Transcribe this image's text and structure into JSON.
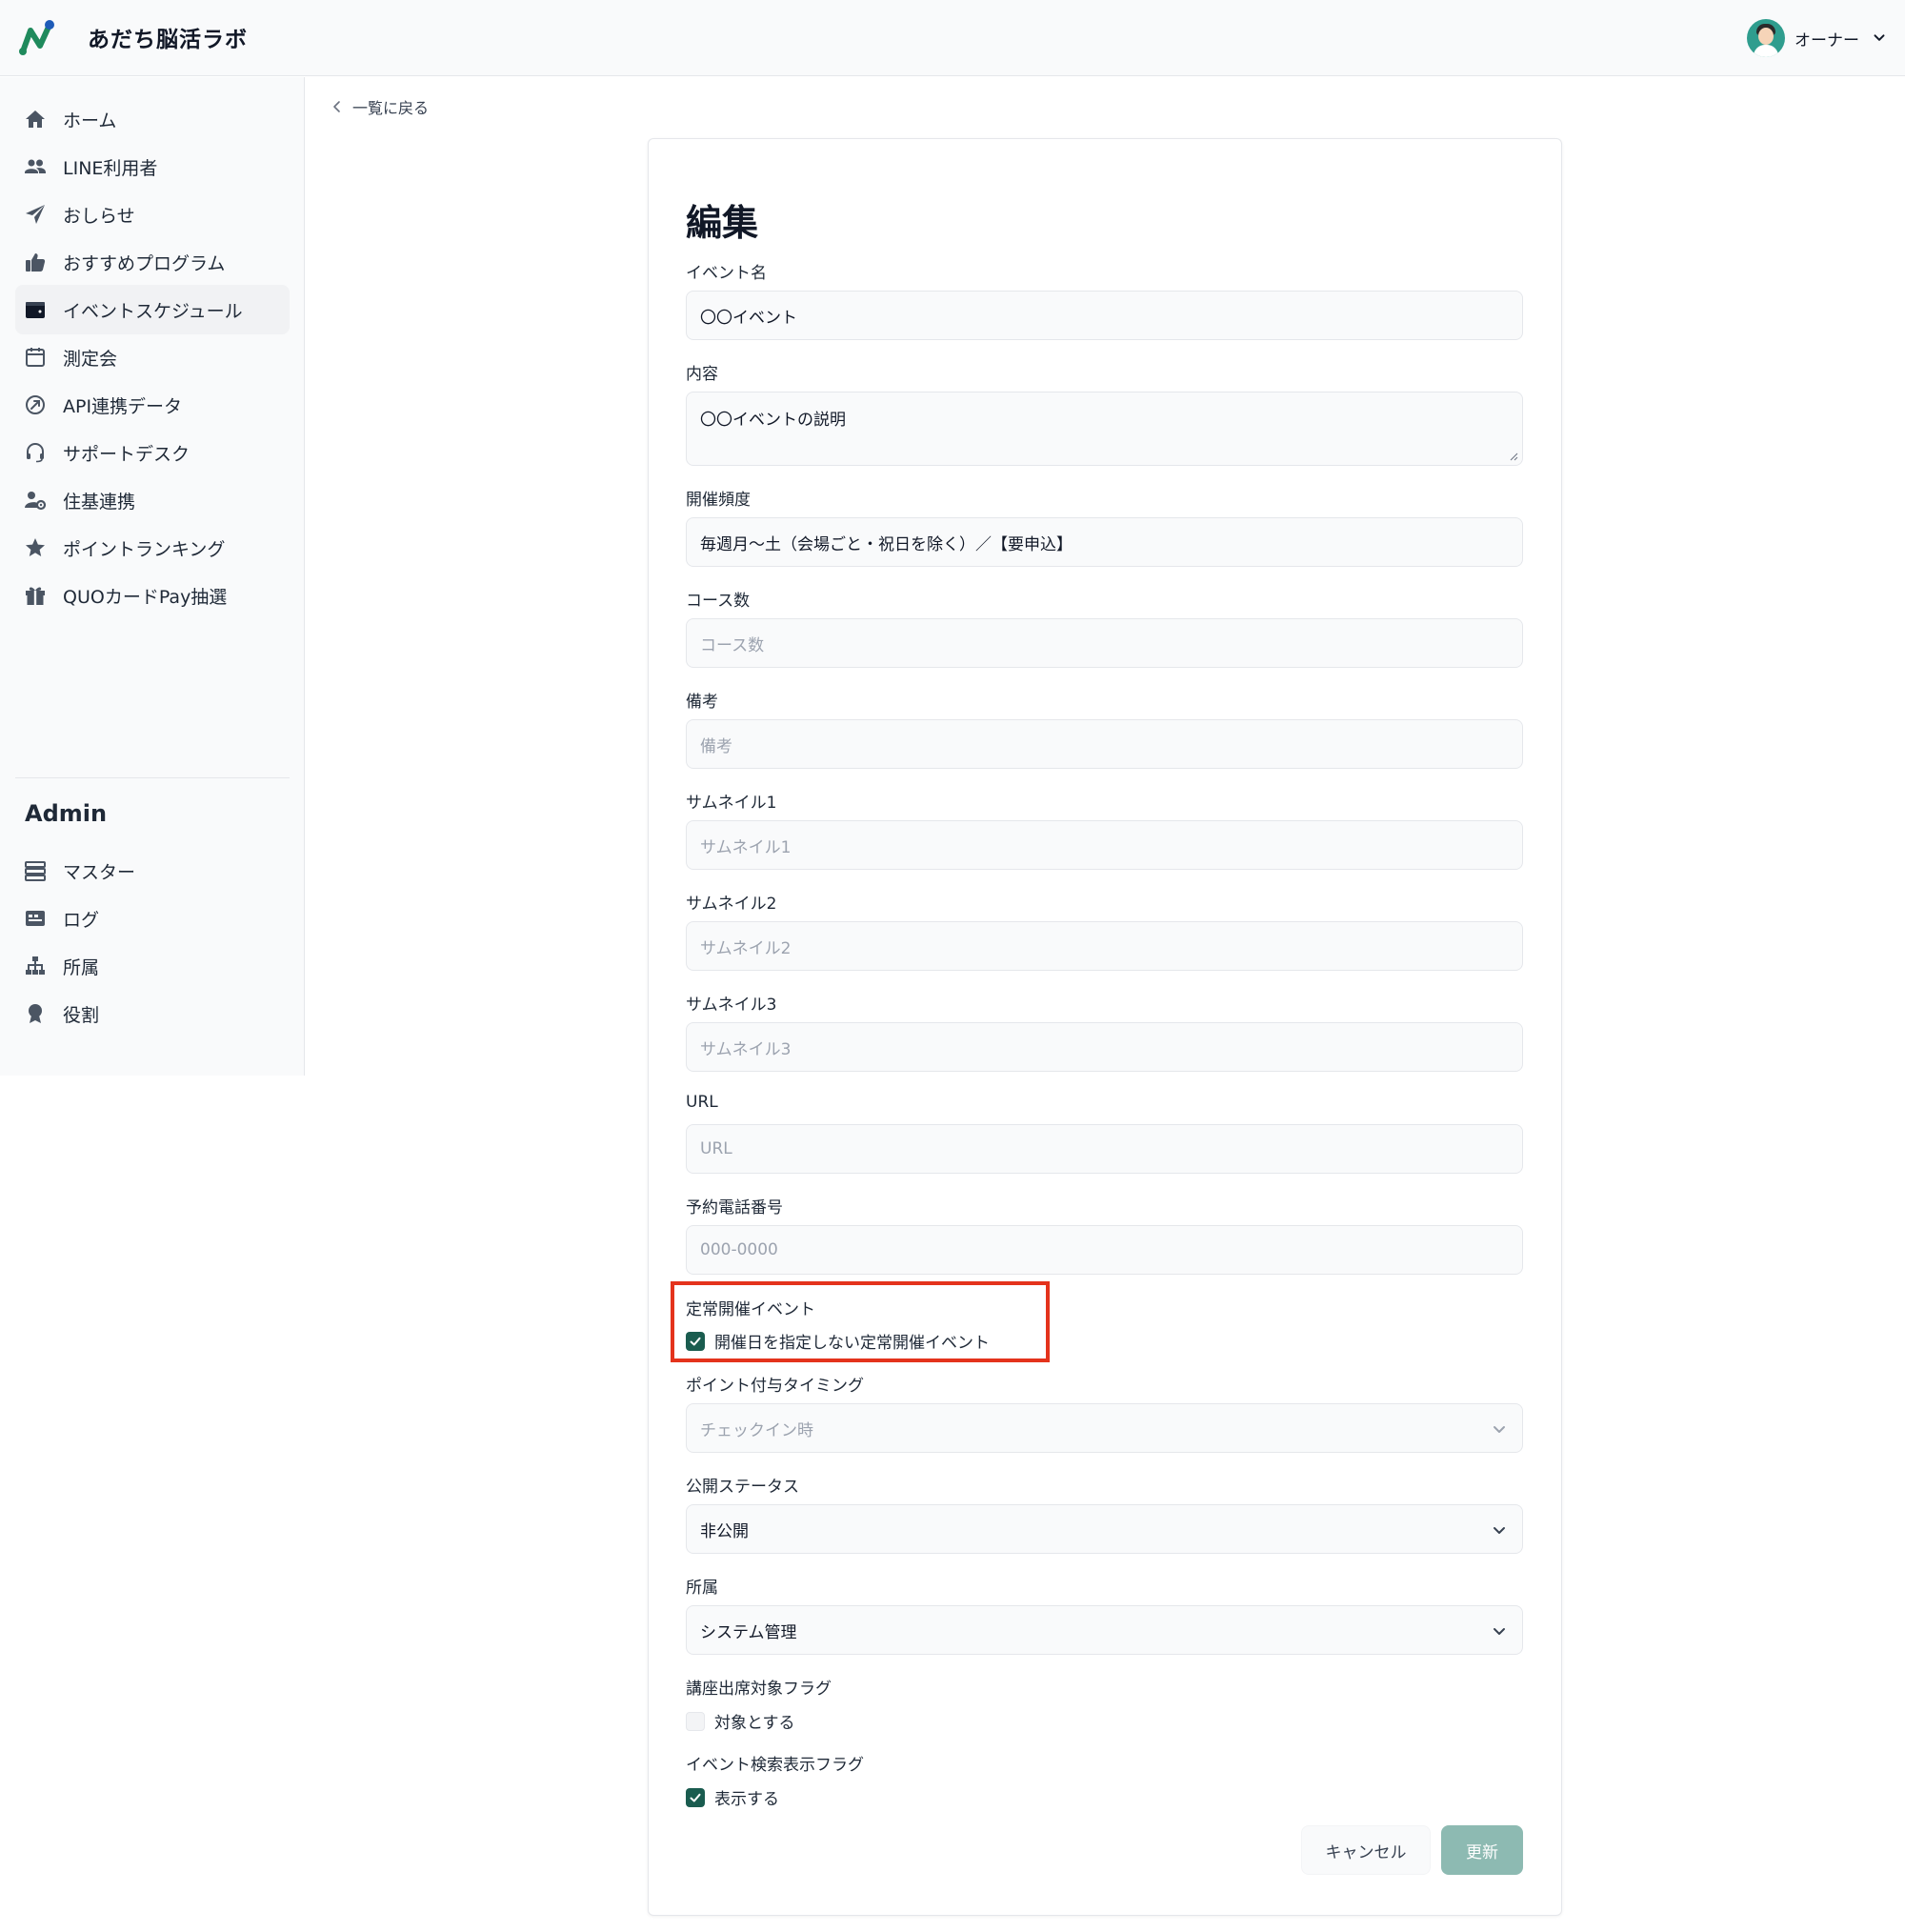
{
  "app": {
    "title": "あだち脳活ラボ"
  },
  "user": {
    "name": "オーナー"
  },
  "sidebar": {
    "items": [
      {
        "label": "ホーム",
        "icon": "home-icon"
      },
      {
        "label": "LINE利用者",
        "icon": "users-icon"
      },
      {
        "label": "おしらせ",
        "icon": "paper-plane-icon"
      },
      {
        "label": "おすすめプログラム",
        "icon": "thumbs-up-icon"
      },
      {
        "label": "イベントスケジュール",
        "icon": "wallet-icon",
        "active": true
      },
      {
        "label": "測定会",
        "icon": "calendar-icon"
      },
      {
        "label": "API連携データ",
        "icon": "api-link-icon"
      },
      {
        "label": "サポートデスク",
        "icon": "headset-icon"
      },
      {
        "label": "住基連携",
        "icon": "user-gear-icon"
      },
      {
        "label": "ポイントランキング",
        "icon": "star-icon"
      },
      {
        "label": "QUOカードPay抽選",
        "icon": "gift-icon"
      }
    ],
    "admin_heading": "Admin",
    "admin_items": [
      {
        "label": "マスター",
        "icon": "server-icon"
      },
      {
        "label": "ログ",
        "icon": "log-card-icon"
      },
      {
        "label": "所属",
        "icon": "sitemap-icon"
      },
      {
        "label": "役割",
        "icon": "award-icon"
      }
    ]
  },
  "main": {
    "back_label": "一覧に戻る",
    "title": "編集",
    "form": {
      "event_name": {
        "label": "イベント名",
        "value": "〇〇イベント"
      },
      "content": {
        "label": "内容",
        "value": "〇〇イベントの説明"
      },
      "frequency": {
        "label": "開催頻度",
        "value": "毎週月〜土（会場ごと・祝日を除く）／【要申込】"
      },
      "course_count": {
        "label": "コース数",
        "placeholder": "コース数"
      },
      "notes": {
        "label": "備考",
        "placeholder": "備考"
      },
      "thumbnail1": {
        "label": "サムネイル1",
        "placeholder": "サムネイル1"
      },
      "thumbnail2": {
        "label": "サムネイル2",
        "placeholder": "サムネイル2"
      },
      "thumbnail3": {
        "label": "サムネイル3",
        "placeholder": "サムネイル3"
      },
      "url": {
        "label": "URL",
        "placeholder": "URL"
      },
      "phone": {
        "label": "予約電話番号",
        "placeholder": "000-0000"
      },
      "recurring": {
        "label": "定常開催イベント",
        "checkbox_label": "開催日を指定しない定常開催イベント",
        "checked": true
      },
      "point_timing": {
        "label": "ポイント付与タイミング",
        "value": "チェックイン時",
        "disabled": true
      },
      "publish_status": {
        "label": "公開ステータス",
        "value": "非公開"
      },
      "affiliation": {
        "label": "所属",
        "value": "システム管理"
      },
      "attendance_flag": {
        "label": "講座出席対象フラグ",
        "checkbox_label": "対象とする",
        "checked": false
      },
      "search_flag": {
        "label": "イベント検索表示フラグ",
        "checkbox_label": "表示する",
        "checked": true
      }
    },
    "buttons": {
      "cancel": "キャンセル",
      "update": "更新"
    }
  },
  "colors": {
    "accent": "#1a5c4f",
    "highlight": "#e4331c",
    "update_button": "#8dbab2"
  }
}
